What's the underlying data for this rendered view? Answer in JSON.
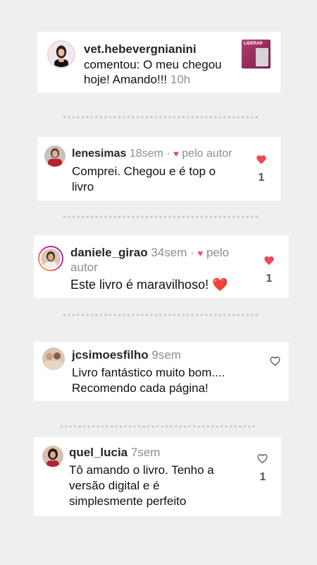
{
  "notification": {
    "username": "vet.hebevergnianini",
    "text_line1": "comentou: O meu chegou",
    "text_line2": "hoje! Amando!!!",
    "time": "10h",
    "thumb_label": "LIDERAR"
  },
  "comments": [
    {
      "username": "lenesimas",
      "time": "18sem",
      "author_tag": "pelo autor",
      "text_line1": "Comprei. Chegou e é  top o",
      "text_line2": "livro",
      "liked": true,
      "likes": "1"
    },
    {
      "username": "daniele_girao",
      "time": "34sem",
      "author_tag_a": "pelo",
      "author_tag_b": "autor",
      "text": "Este livro é maravilhoso! ❤️",
      "liked": true,
      "likes": "1"
    },
    {
      "username": "jcsimoesfilho",
      "time": "9sem",
      "text_line1": "Livro fantástico muito bom....",
      "text_line2": "Recomendo cada página!",
      "liked": false
    },
    {
      "username": "quel_lucia",
      "time": "7sem",
      "text_line1": "Tô amando o livro. Tenho a",
      "text_line2": "versão digital e é",
      "text_line3": "simplesmente perfeito",
      "liked": false,
      "likes": "1"
    }
  ],
  "colors": {
    "heart": "#ed4956",
    "meta": "#8e8e8e",
    "background": "#efefef"
  },
  "icons": {
    "heart_filled": "heart-filled-icon",
    "heart_outline": "heart-outline-icon"
  }
}
